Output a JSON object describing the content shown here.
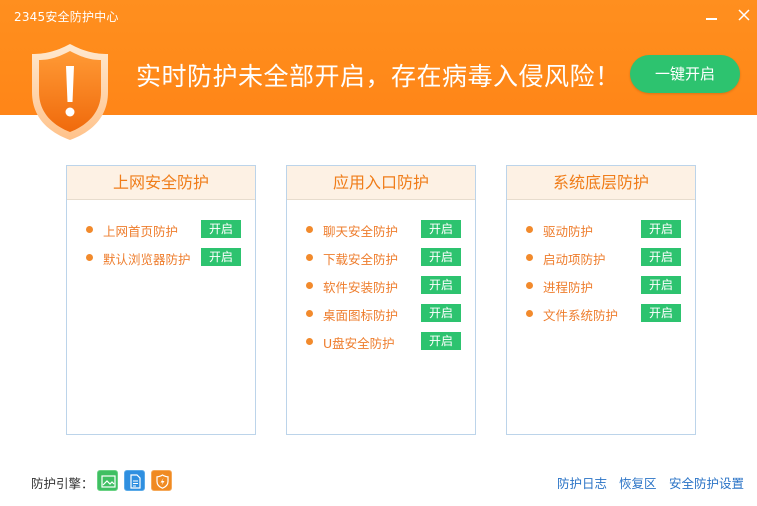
{
  "window": {
    "title": "2345安全防护中心",
    "min_icon": "minimize-icon",
    "close_icon": "close-icon"
  },
  "header": {
    "shield_icon": "warning-shield-icon",
    "headline": "实时防护未全部开启，存在病毒入侵风险！",
    "enable_all_label": "一键开启",
    "colors": {
      "background": "#ff8a1a",
      "button": "#2dc36f"
    }
  },
  "panels": [
    {
      "title": "上网安全防护",
      "items": [
        {
          "label": "上网首页防护",
          "button": "开启"
        },
        {
          "label": "默认浏览器防护",
          "button": "开启"
        }
      ]
    },
    {
      "title": "应用入口防护",
      "items": [
        {
          "label": "聊天安全防护",
          "button": "开启"
        },
        {
          "label": "下载安全防护",
          "button": "开启"
        },
        {
          "label": "软件安装防护",
          "button": "开启"
        },
        {
          "label": "桌面图标防护",
          "button": "开启"
        },
        {
          "label": "U盘安全防护",
          "button": "开启"
        }
      ]
    },
    {
      "title": "系统底层防护",
      "items": [
        {
          "label": "驱动防护",
          "button": "开启"
        },
        {
          "label": "启动项防护",
          "button": "开启"
        },
        {
          "label": "进程防护",
          "button": "开启"
        },
        {
          "label": "文件系统防护",
          "button": "开启"
        }
      ]
    }
  ],
  "footer": {
    "engine_label": "防护引擎：",
    "engines": [
      "image-engine-icon",
      "document-engine-icon",
      "shield-engine-icon"
    ],
    "links": {
      "log": "防护日志",
      "restore": "恢复区",
      "settings": "安全防护设置"
    }
  }
}
